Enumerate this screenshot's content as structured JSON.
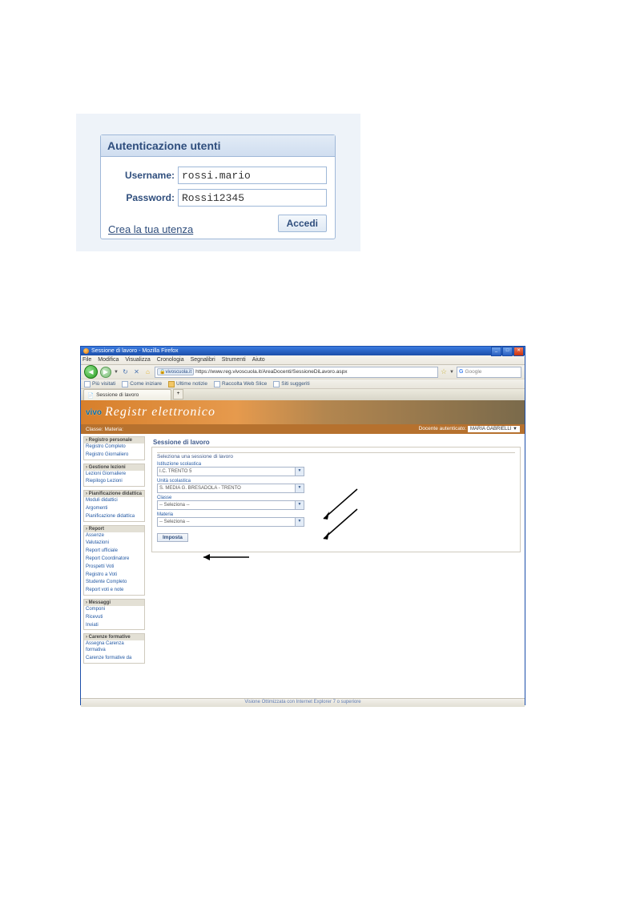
{
  "login": {
    "heading": "Autenticazione utenti",
    "username_label": "Username:",
    "username_value": "rossi.mario",
    "password_label": "Password:",
    "password_value": "Rossi12345",
    "submit_label": "Accedi",
    "create_account_link": "Crea la tua utenza"
  },
  "browser": {
    "window_title": "Sessione di lavoro - Mozilla Firefox",
    "menu": [
      "File",
      "Modifica",
      "Visualizza",
      "Cronologia",
      "Segnalibri",
      "Strumenti",
      "Aiuto"
    ],
    "url_host": "vivoscuola.it",
    "url": "https://www.reg.vivoscuola.it/AreaDocenti/SessioneDiLavoro.aspx",
    "search_placeholder": "Google",
    "bookmarks": [
      {
        "label": "Più visitati",
        "folder": false
      },
      {
        "label": "Come iniziare",
        "folder": false
      },
      {
        "label": "Ultime notizie",
        "folder": true
      },
      {
        "label": "Raccolta Web Slice",
        "folder": false
      },
      {
        "label": "Siti suggeriti",
        "folder": false
      }
    ],
    "tab_title": "Sessione di lavoro"
  },
  "site": {
    "logo": "vivo",
    "brand": "Registr   elettronico",
    "subbar_left": "Classe: Materia:",
    "subbar_right_label": "Docente autenticato:",
    "subbar_right_value": "MARIA GABRIELLI"
  },
  "sidebar": {
    "groups": [
      {
        "title": "Registro personale",
        "items": [
          "Registro Completo",
          "Registro Giornaliero"
        ]
      },
      {
        "title": "Gestione lezioni",
        "items": [
          "Lezioni Giornaliere",
          "Riepilogo Lezioni"
        ]
      },
      {
        "title": "Pianificazione didattica",
        "items": [
          "Moduli didattici",
          "Argomenti",
          "Pianificazione didattica"
        ]
      },
      {
        "title": "Report",
        "items": [
          "Assenze",
          "Valutazioni",
          "Report ufficiale",
          "Report Coordinatore",
          "Prospetti Voti",
          "Registro a Voti",
          "Studente Completo",
          "Report voti e note"
        ]
      },
      {
        "title": "Messaggi",
        "items": [
          "Componi",
          "Ricevuti",
          "Inviati"
        ]
      },
      {
        "title": "Carenze formative",
        "items": [
          "Assegna Carenza formativa",
          "Carenze formative da"
        ]
      }
    ]
  },
  "session_form": {
    "page_title": "Sessione di lavoro",
    "fieldset_label": "Seleziona una sessione di lavoro",
    "istituzione_label": "Istituzione scolastica",
    "istituzione_value": "I.C. TRENTO 5",
    "unita_label": "Unità scolastica",
    "unita_value": "S. MEDIA G. BRESADOLA - TRENTO",
    "classe_label": "Classe",
    "classe_value": "-- Seleziona --",
    "materia_label": "Materia",
    "materia_value": "-- Seleziona --",
    "submit": "Imposta"
  },
  "statusbar": "Visione Ottimizzata con Internet Explorer 7 o superiore"
}
